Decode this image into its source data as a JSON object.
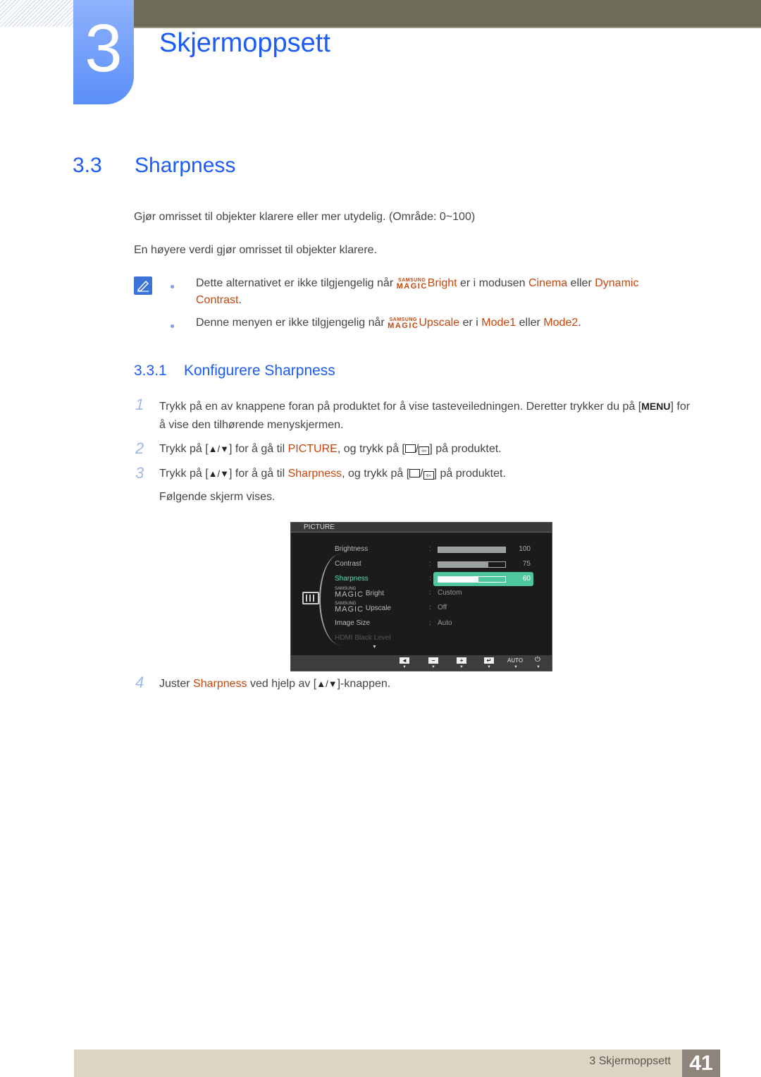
{
  "chapter": {
    "number": "3",
    "title": "Skjermoppsett"
  },
  "section": {
    "number": "3.3",
    "title": "Sharpness"
  },
  "intro": [
    "Gjør omrisset til objekter klarere eller mer utydelig. (Område: 0~100)",
    "En høyere verdi gjør omrisset til objekter klarere."
  ],
  "notes": {
    "icon": "note-pencil-icon",
    "items": [
      {
        "pre": "Dette alternativet er ikke tilgjengelig når ",
        "magic_s": "SAMSUNG",
        "magic_m": "MAGIC",
        "feature": "Bright",
        "mid": " er i modusen ",
        "opt1": "Cinema",
        "join": " eller ",
        "opt2": "Dynamic Contrast",
        "end": "."
      },
      {
        "pre": "Denne menyen er ikke tilgjengelig når ",
        "magic_s": "SAMSUNG",
        "magic_m": "MAGIC",
        "feature": "Upscale",
        "mid": " er i ",
        "opt1": "Mode1",
        "join": " eller ",
        "opt2": "Mode2",
        "end": "."
      }
    ]
  },
  "subsection": {
    "number": "3.3.1",
    "title": "Konfigurere Sharpness"
  },
  "steps": [
    {
      "num": "1",
      "a": "Trykk på en av knappene foran på produktet for å vise tasteveiledningen. Deretter trykker du på ",
      "key": "MENU",
      "b": " for å vise den tilhørende menyskjermen."
    },
    {
      "num": "2",
      "a": "Trykk på [",
      "arrows": "▲/▼",
      "b": "] for å gå til ",
      "target": "PICTURE",
      "c": ", og trykk på [",
      "d": "] på produktet."
    },
    {
      "num": "3",
      "a": "Trykk på [",
      "arrows": "▲/▼",
      "b": "] for å gå til ",
      "target": "Sharpness",
      "c": ", og trykk på [",
      "d": "] på produktet.",
      "after": "Følgende skjerm vises."
    },
    {
      "num": "4",
      "a": "Juster ",
      "target": "Sharpness",
      "b": " ved hjelp av [",
      "arrows": "▲/▼",
      "c": "]-knappen."
    }
  ],
  "osd": {
    "header": "PICTURE",
    "rows": [
      {
        "label": "Brightness",
        "value": 100
      },
      {
        "label": "Contrast",
        "value": 75
      },
      {
        "label": "Sharpness",
        "value": 60,
        "selected": true
      },
      {
        "magic_s": "SAMSUNG",
        "magic_m": "MAGIC",
        "label": "Bright",
        "text": "Custom"
      },
      {
        "magic_s": "SAMSUNG",
        "magic_m": "MAGIC",
        "label": "Upscale",
        "text": "Off"
      },
      {
        "label": "Image Size",
        "text": "Auto"
      },
      {
        "label": "HDMI Black Level",
        "disabled": true
      }
    ],
    "footer_buttons": [
      "◄",
      "−",
      "+",
      "↵",
      "AUTO",
      "⏻"
    ],
    "colors": {
      "selected": "#4ec7a0",
      "background": "#1b1b1b"
    }
  },
  "footer": {
    "chapter_label": "3 Skjermoppsett",
    "page": "41"
  },
  "colors": {
    "heading": "#1a5cf5",
    "highlight": "#c8460c",
    "topbar": "#6e6b58"
  }
}
